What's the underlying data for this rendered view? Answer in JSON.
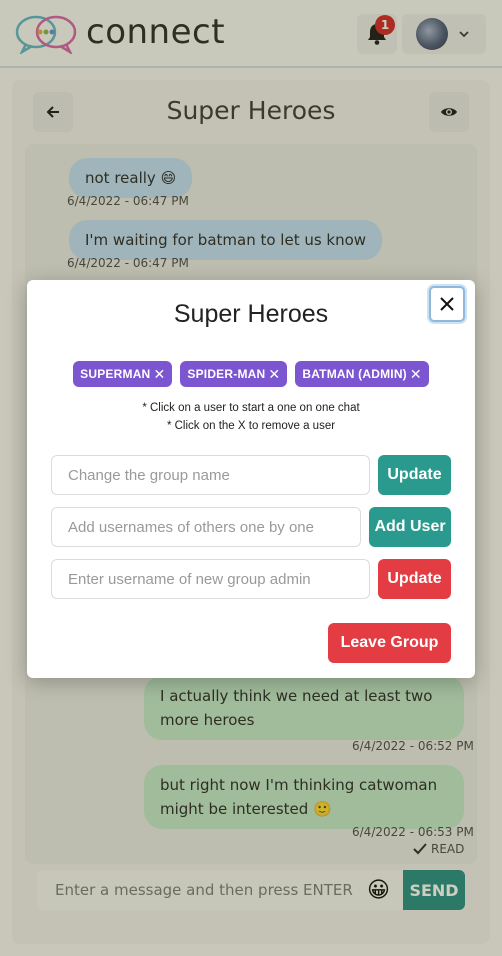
{
  "app": {
    "brand": "connect",
    "notification_count": "1"
  },
  "chat": {
    "title": "Super Heroes",
    "messages": [
      {
        "text": "not really 😄",
        "time": "6/4/2022 - 06:47 PM",
        "side": "left"
      },
      {
        "text": "I'm waiting for batman to let us know",
        "time": "6/4/2022 - 06:47 PM",
        "side": "left"
      },
      {
        "text": "I actually think we need at least two more heroes",
        "time": "6/4/2022 - 06:52 PM",
        "side": "right"
      },
      {
        "text": "but right now I'm thinking catwoman might be interested 🙂",
        "time": "6/4/2022 - 06:53 PM",
        "side": "right"
      }
    ],
    "read_label": "READ",
    "input_placeholder": "Enter a message and then press ENTER",
    "send_label": "SEND"
  },
  "modal": {
    "title": "Super Heroes",
    "members": [
      "SUPERMAN",
      "SPIDER-MAN",
      "BATMAN (ADMIN)"
    ],
    "hint_1": "* Click on a user to start a one on one chat",
    "hint_2": "* Click on the X to remove a user",
    "group_name_placeholder": "Change the group name",
    "update_label": "Update",
    "add_users_placeholder": "Add usernames of others one by one",
    "add_user_label": "Add User",
    "admin_placeholder": "Enter username of new group admin",
    "update_admin_label": "Update",
    "leave_label": "Leave Group"
  },
  "colors": {
    "tag": "#7c55d1",
    "teal": "#2a9a8e",
    "red": "#e33c42",
    "left_bubble": "#bfdcf4",
    "right_bubble": "#bfe7c8"
  }
}
